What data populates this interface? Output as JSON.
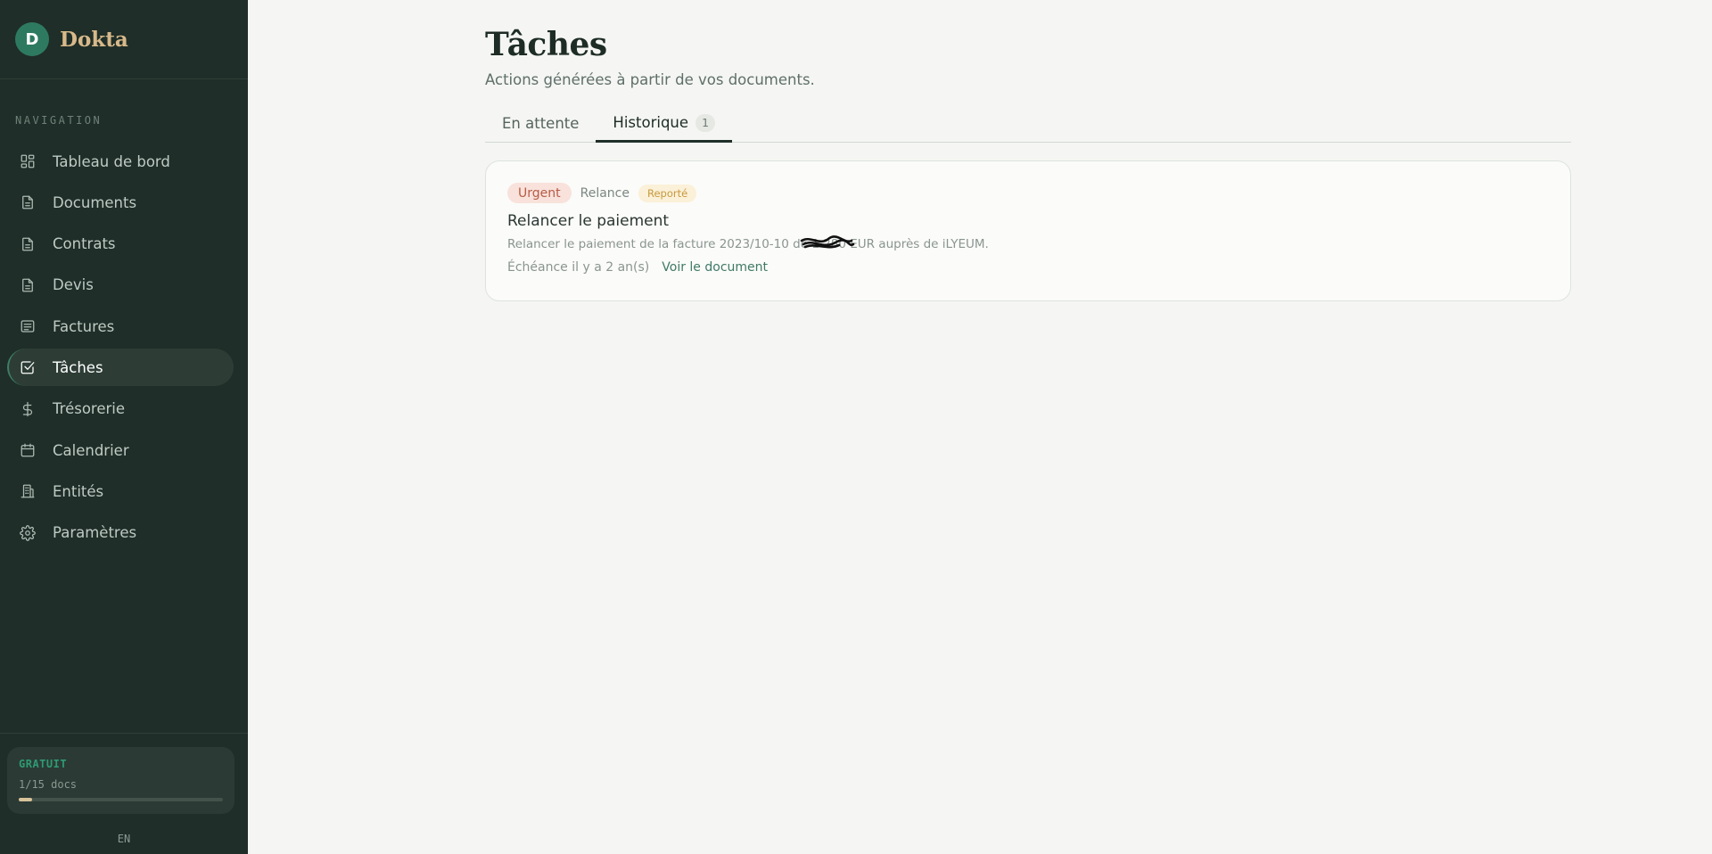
{
  "brand": {
    "initial": "D",
    "name": "Dokta"
  },
  "sidebar": {
    "heading": "NAVIGATION",
    "items": [
      {
        "label": "Tableau de bord",
        "icon": "dashboard-icon"
      },
      {
        "label": "Documents",
        "icon": "document-icon"
      },
      {
        "label": "Contrats",
        "icon": "document-icon"
      },
      {
        "label": "Devis",
        "icon": "document-icon"
      },
      {
        "label": "Factures",
        "icon": "invoice-icon"
      },
      {
        "label": "Tâches",
        "icon": "checkbox-icon",
        "active": true
      },
      {
        "label": "Trésorerie",
        "icon": "dollar-icon"
      },
      {
        "label": "Calendrier",
        "icon": "calendar-icon"
      },
      {
        "label": "Entités",
        "icon": "building-icon"
      },
      {
        "label": "Paramètres",
        "icon": "gear-icon"
      }
    ],
    "plan": {
      "name": "GRATUIT",
      "usage": "1/15 docs",
      "used": 1,
      "limit": 15
    },
    "language": "EN"
  },
  "main": {
    "title": "Tâches",
    "subtitle": "Actions générées à partir de vos documents.",
    "tabs": [
      {
        "label": "En attente",
        "active": false
      },
      {
        "label": "Historique",
        "active": true,
        "count": "1"
      }
    ],
    "tasks": [
      {
        "priority": "Urgent",
        "type": "Relance",
        "status": "Reporté",
        "title": "Relancer le paiement",
        "description": "Relancer le paiement de la facture 2023/10-10 de 1 280 EUR auprès de iLYEUM.",
        "due": "Échéance il y a 2 an(s)",
        "link": "Voir le document"
      }
    ]
  },
  "colors": {
    "sidebar_bg": "#1f2e28",
    "accent": "#2e7a60",
    "brand_text": "#d8b98a",
    "urgent_bg": "#f8e2db",
    "urgent_text": "#b85b47",
    "status_bg": "#fbf0d8",
    "status_text": "#c79a3e"
  }
}
